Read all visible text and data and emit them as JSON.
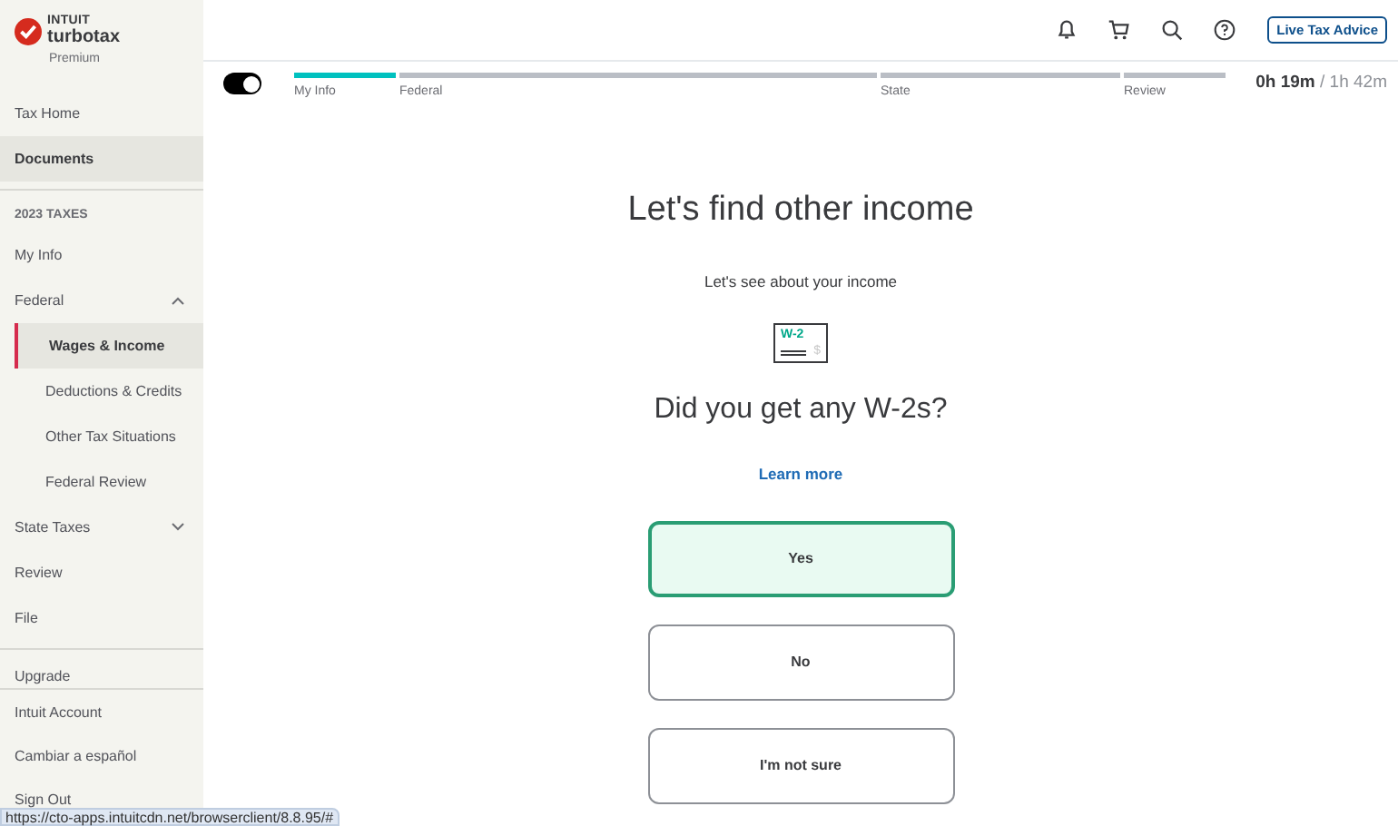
{
  "brand": {
    "company": "INTUIT",
    "product": "turbotax",
    "edition": "Premium"
  },
  "sidebar": {
    "top_items": [
      {
        "label": "Tax Home",
        "selected": false
      },
      {
        "label": "Documents",
        "selected": true
      }
    ],
    "section_title": "2023 TAXES",
    "items": [
      {
        "label": "My Info",
        "selected": false
      },
      {
        "label": "Federal",
        "selected": false,
        "expanded": true,
        "children": [
          {
            "label": "Wages & Income",
            "selected": true
          },
          {
            "label": "Deductions & Credits",
            "selected": false
          },
          {
            "label": "Other Tax Situations",
            "selected": false
          },
          {
            "label": "Federal Review",
            "selected": false
          }
        ]
      },
      {
        "label": "State Taxes",
        "selected": false,
        "expanded": false
      },
      {
        "label": "Review",
        "selected": false
      },
      {
        "label": "File",
        "selected": false
      }
    ],
    "upgrade": "Upgrade",
    "bottom_items": [
      {
        "label": "Intuit Account"
      },
      {
        "label": "Cambiar a español"
      },
      {
        "label": "Sign Out"
      }
    ]
  },
  "header": {
    "live_button": "Live Tax Advice"
  },
  "progress": {
    "toggle_on": true,
    "steps": [
      {
        "label": "My Info",
        "level": 1
      },
      {
        "label": "Federal",
        "level": 0
      },
      {
        "label": "State",
        "level": 0
      },
      {
        "label": "Review",
        "level": 0
      }
    ],
    "timer": "**0h 19m** / 1h 42m"
  },
  "main": {
    "title": "Let's find other income",
    "subtitle": "Let's see about your income",
    "form_icon": {
      "label": "W-2",
      "symbol": "$"
    },
    "question": "Did you get any W-2s?",
    "link": "Learn more",
    "options": [
      {
        "label": "Yes",
        "selected": true
      },
      {
        "label": "No",
        "selected": false
      },
      {
        "label": "I'm not sure",
        "selected": false
      }
    ]
  },
  "status_url": "https://cto-apps.intuitcdn.net/browserclient/8.8.95/#"
}
